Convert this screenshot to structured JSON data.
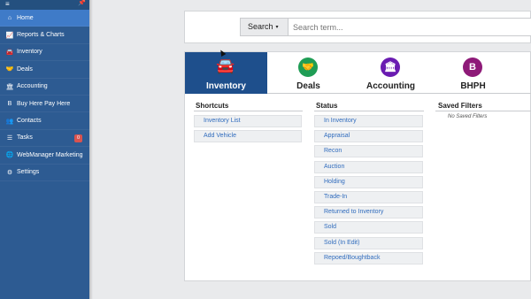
{
  "sidebar": {
    "items": [
      {
        "label": "Home",
        "icon": "home-icon",
        "glyph": "⌂",
        "active": true
      },
      {
        "label": "Reports & Charts",
        "icon": "chart-icon",
        "glyph": "📈"
      },
      {
        "label": "Inventory",
        "icon": "car-icon",
        "glyph": "🚘"
      },
      {
        "label": "Deals",
        "icon": "handshake-icon",
        "glyph": "🤝"
      },
      {
        "label": "Accounting",
        "icon": "bank-icon",
        "glyph": "🏛"
      },
      {
        "label": "Buy Here Pay Here",
        "icon": "bhph-icon",
        "glyph": "B"
      },
      {
        "label": "Contacts",
        "icon": "contacts-icon",
        "glyph": "👥"
      },
      {
        "label": "Tasks",
        "icon": "list-icon",
        "glyph": "☰",
        "badge": "0"
      },
      {
        "label": "WebManager Marketing",
        "icon": "globe-icon",
        "glyph": "🌐"
      },
      {
        "label": "Settings",
        "icon": "gear-icon",
        "glyph": "⚙"
      }
    ],
    "menu_glyph": "≡",
    "pin_glyph": "📌"
  },
  "search": {
    "button_label": "Search",
    "caret": "▾",
    "placeholder": "Search term..."
  },
  "tabs": [
    {
      "label": "Inventory",
      "icon": "car-icon",
      "glyph": "🚘",
      "active": true
    },
    {
      "label": "Deals",
      "icon": "handshake-icon",
      "glyph": "🤝",
      "color": "#1f9d55"
    },
    {
      "label": "Accounting",
      "icon": "bank-icon",
      "glyph": "🏛",
      "color": "#6a1bb1"
    },
    {
      "label": "BHPH",
      "icon": "bhph-icon",
      "glyph": "B",
      "color": "#8e1a78"
    }
  ],
  "sections": {
    "shortcuts": {
      "title": "Shortcuts",
      "items": [
        "Inventory List",
        "Add Vehicle"
      ]
    },
    "status": {
      "title": "Status",
      "items": [
        "In Inventory",
        "Appraisal",
        "Recon",
        "Auction",
        "Holding",
        "Trade-In",
        "Returned to Inventory",
        "Sold",
        "Sold (In Edit)",
        "Repoed/Boughtback"
      ]
    },
    "saved_filters": {
      "title": "Saved Filters",
      "empty_text": "No Saved Filters"
    }
  },
  "colors": {
    "sidebar_bg": "#2d5b92",
    "sidebar_active": "#3f7bc8",
    "tab_active": "#1e4f8c",
    "link": "#2f6bbd",
    "badge": "#d9534f"
  }
}
